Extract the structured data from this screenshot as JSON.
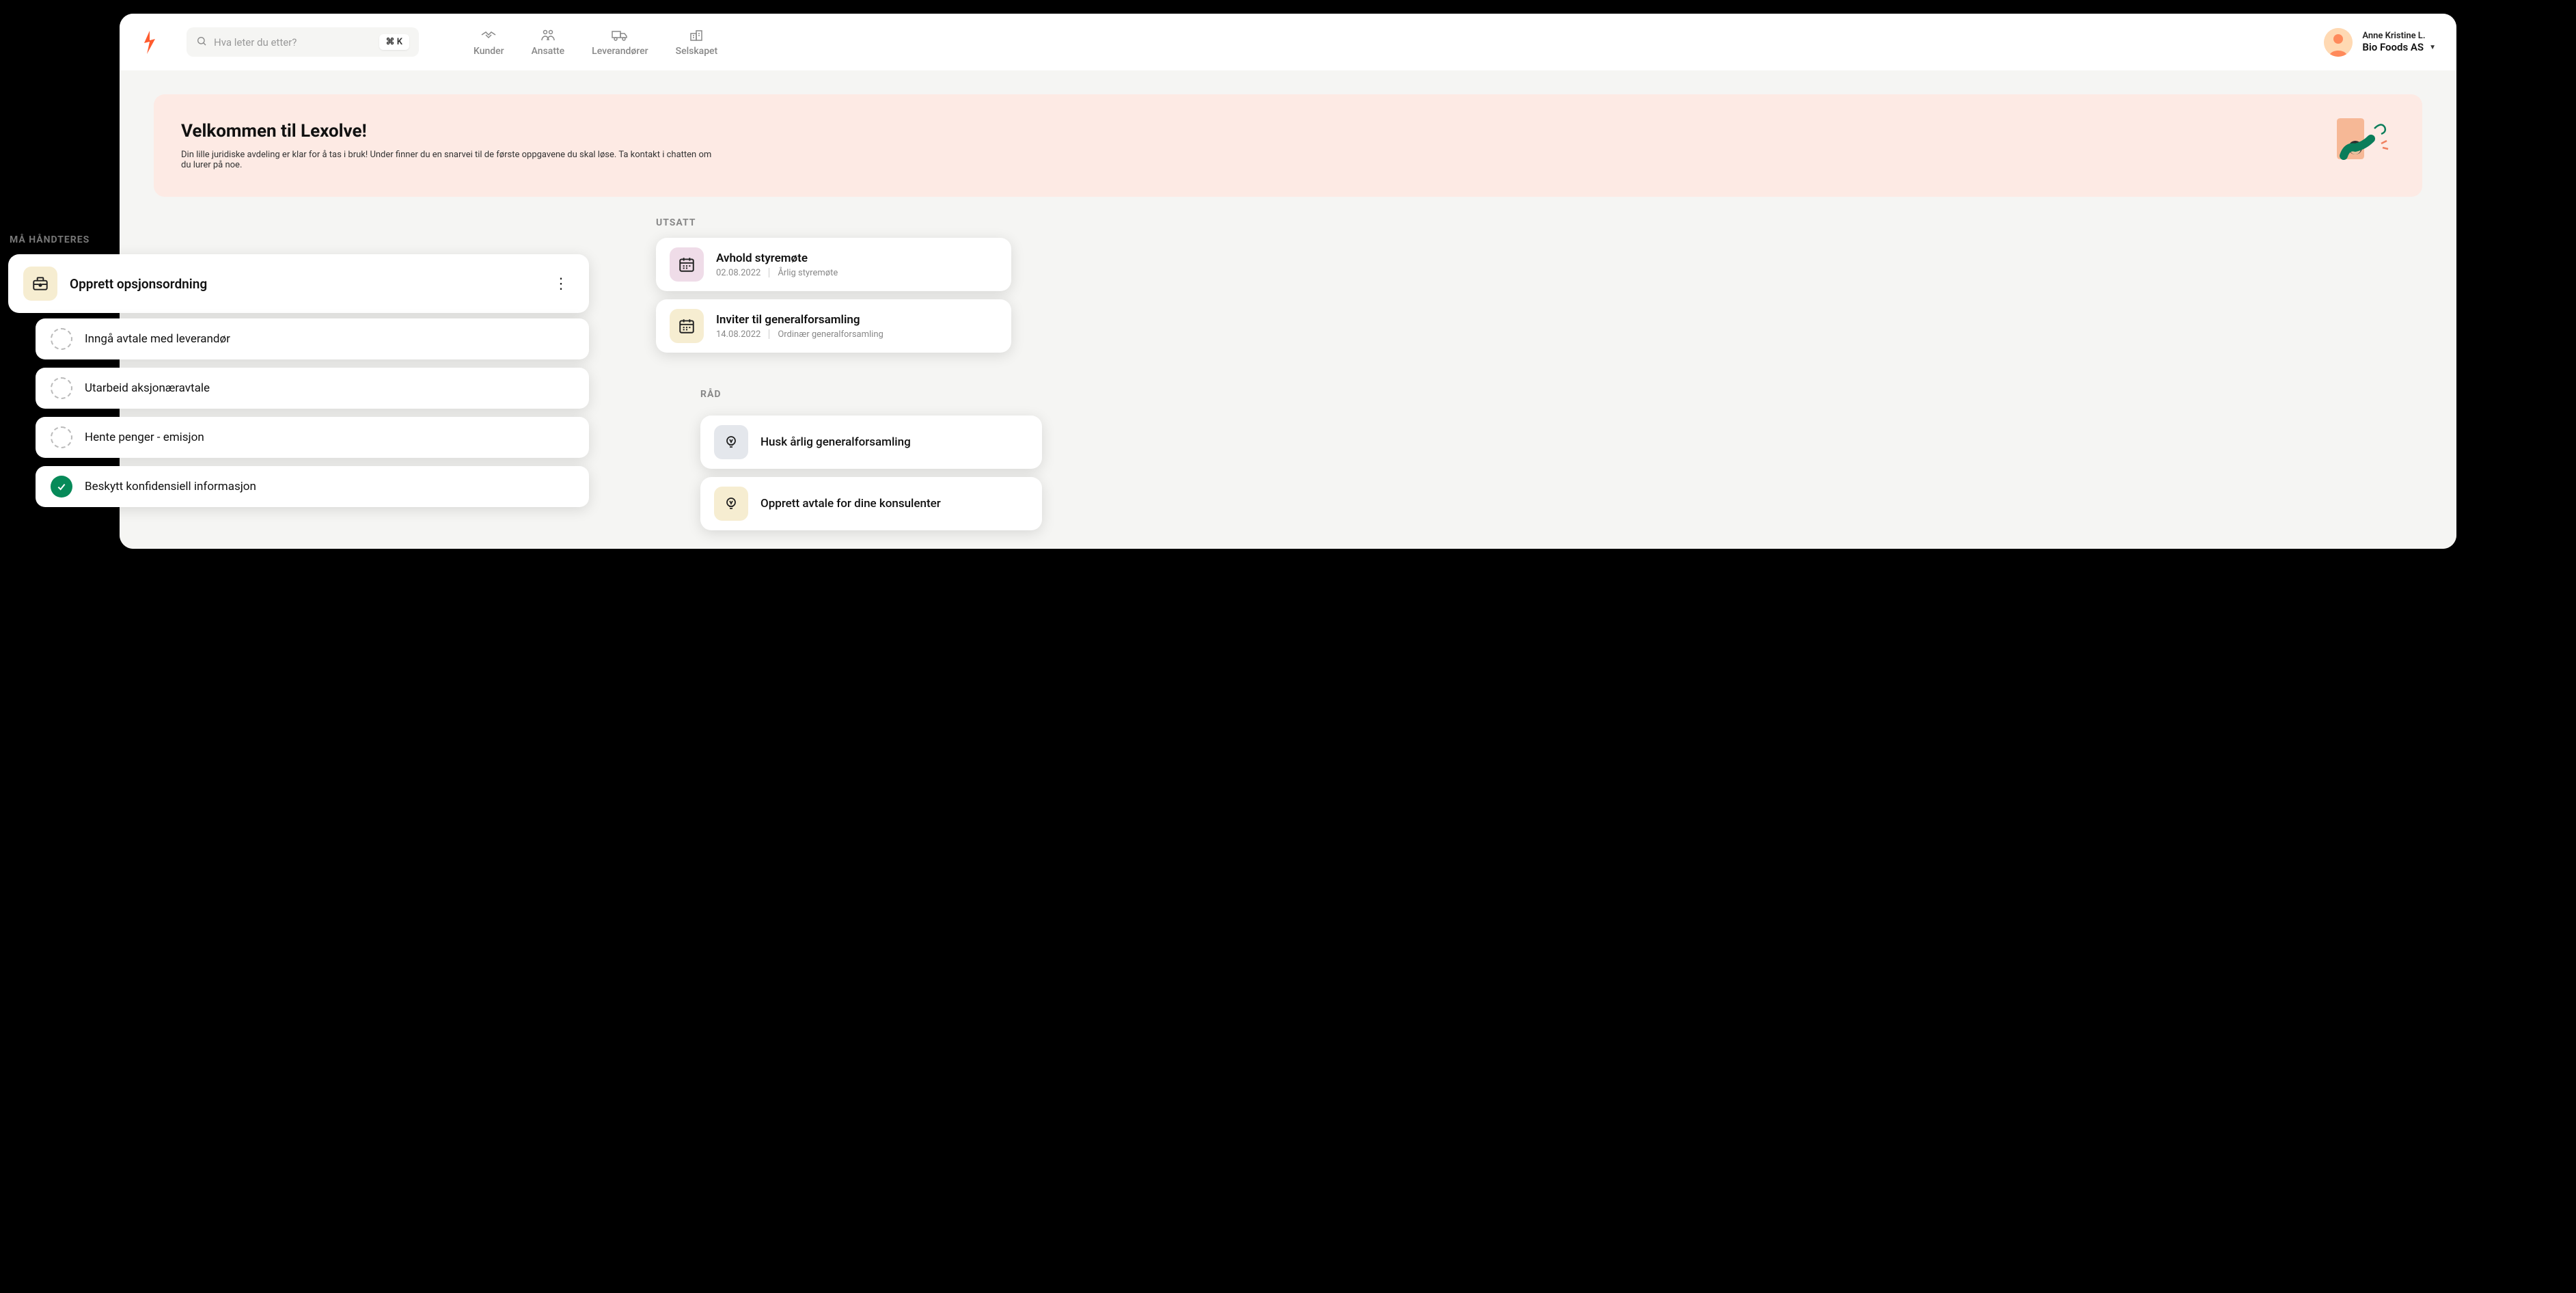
{
  "search": {
    "placeholder": "Hva leter du etter?",
    "shortcut": "⌘ K"
  },
  "nav": {
    "items": [
      {
        "label": "Kunder"
      },
      {
        "label": "Ansatte"
      },
      {
        "label": "Leverandører"
      },
      {
        "label": "Selskapet"
      }
    ]
  },
  "user": {
    "name": "Anne Kristine L.",
    "company": "Bio Foods AS"
  },
  "welcome": {
    "title": "Velkommen til Lexolve!",
    "subtitle": "Din lille juridiske avdeling er klar for å tas i bruk! Under finner du en snarvei til de første oppgavene du skal løse. Ta kontakt i chatten om du lurer på noe."
  },
  "tasks": {
    "section_label": "MÅ HÅNDTERES",
    "primary": {
      "title": "Opprett opsjonsordning"
    },
    "items": [
      {
        "label": "Inngå avtale med leverandør",
        "done": false
      },
      {
        "label": "Utarbeid aksjonæravtale",
        "done": false
      },
      {
        "label": "Hente penger - emisjon",
        "done": false
      },
      {
        "label": "Beskytt konfidensiell informasjon",
        "done": true
      }
    ]
  },
  "utsatt": {
    "section_label": "UTSATT",
    "items": [
      {
        "title": "Avhold styremøte",
        "date": "02.08.2022",
        "meta": "Årlig styremøte"
      },
      {
        "title": "Inviter til generalforsamling",
        "date": "14.08.2022",
        "meta": "Ordinær generalforsamling"
      }
    ]
  },
  "rad": {
    "section_label": "RÅD",
    "items": [
      {
        "title": "Husk årlig generalforsamling"
      },
      {
        "title": "Opprett avtale for dine konsulenter"
      }
    ]
  }
}
